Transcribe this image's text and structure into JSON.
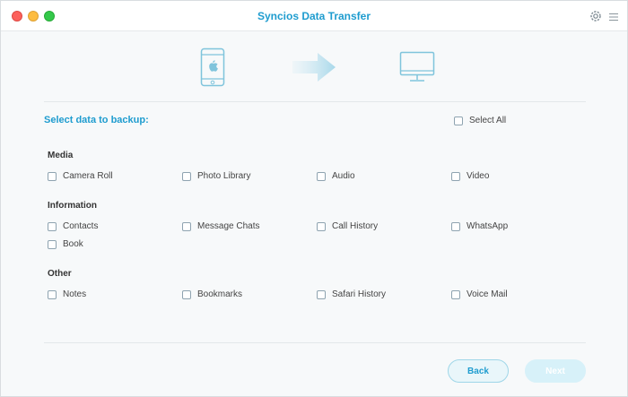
{
  "window": {
    "title": "Syncios Data Transfer"
  },
  "titlebar": {
    "icons": [
      "close-icon",
      "minimize-icon",
      "maximize-icon",
      "gear-icon",
      "menu-icon"
    ]
  },
  "hero": {
    "icons": [
      "iphone-icon",
      "arrow-right-icon",
      "monitor-icon"
    ],
    "accent": "#1e9ccf",
    "icon_color": "#7fc4dc"
  },
  "backup": {
    "prompt": "Select data to backup:",
    "select_all": "Select All"
  },
  "sections": {
    "media": {
      "title": "Media",
      "items": [
        "Camera Roll",
        "Photo Library",
        "Audio",
        "Video"
      ]
    },
    "information": {
      "title": "Information",
      "items": [
        "Contacts",
        "Message Chats",
        "Call History",
        "WhatsApp",
        "Book"
      ]
    },
    "other": {
      "title": "Other",
      "items": [
        "Notes",
        "Bookmarks",
        "Safari History",
        "Voice Mail"
      ]
    }
  },
  "buttons": {
    "back": "Back",
    "next": "Next"
  }
}
